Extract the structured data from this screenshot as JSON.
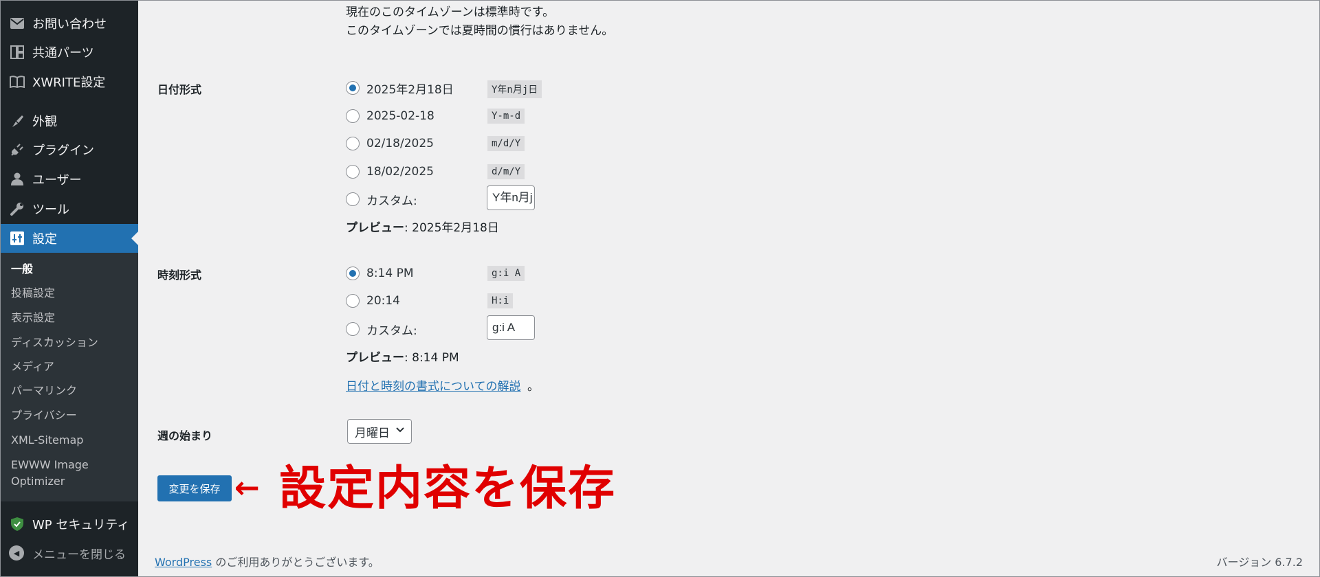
{
  "sidebar": {
    "items": [
      {
        "label": "お問い合わせ",
        "icon": "mail-icon"
      },
      {
        "label": "共通パーツ",
        "icon": "layout-blocks-icon"
      },
      {
        "label": "XWRITE設定",
        "icon": "book-icon"
      },
      {
        "label": "外観",
        "icon": "paintbrush-icon"
      },
      {
        "label": "プラグイン",
        "icon": "plugin-icon"
      },
      {
        "label": "ユーザー",
        "icon": "user-icon"
      },
      {
        "label": "ツール",
        "icon": "wrench-icon"
      },
      {
        "label": "設定",
        "icon": "settings-icon"
      }
    ],
    "submenu": [
      "一般",
      "投稿設定",
      "表示設定",
      "ディスカッション",
      "メディア",
      "パーマリンク",
      "プライバシー",
      "XML-Sitemap",
      "EWWW Image",
      "Optimizer"
    ],
    "security_label": "WP セキュリティ",
    "collapse_label": "メニューを閉じる"
  },
  "timezone": {
    "line1": "現在のこのタイムゾーンは標準時です。",
    "line2": "このタイムゾーンでは夏時間の慣行はありません。"
  },
  "date_format": {
    "heading": "日付形式",
    "options": [
      {
        "label": "2025年2月18日",
        "code": "Y年n月j日"
      },
      {
        "label": "2025-02-18",
        "code": "Y-m-d"
      },
      {
        "label": "02/18/2025",
        "code": "m/d/Y"
      },
      {
        "label": "18/02/2025",
        "code": "d/m/Y"
      }
    ],
    "custom_label": "カスタム:",
    "custom_value": "Y年n月j日",
    "preview_label": "プレビュー",
    "preview_value": ": 2025年2月18日"
  },
  "time_format": {
    "heading": "時刻形式",
    "options": [
      {
        "label": "8:14 PM",
        "code": "g:i A"
      },
      {
        "label": "20:14",
        "code": "H:i"
      }
    ],
    "custom_label": "カスタム:",
    "custom_value": "g:i A",
    "preview_label": "プレビュー",
    "preview_value": ": 8:14 PM",
    "doc_link": "日付と時刻の書式についての解説",
    "doc_suffix": "。"
  },
  "week_start": {
    "heading": "週の始まり",
    "selected": "月曜日"
  },
  "save_label": "変更を保存",
  "annotation": {
    "arrow": "←",
    "text": "設定内容を保存"
  },
  "footer": {
    "link": "WordPress",
    "text": " のご利用ありがとうございます。",
    "version": "バージョン 6.7.2"
  },
  "colors": {
    "sidebar_bg": "#1d2327",
    "submenu_bg": "#2c3338",
    "accent": "#2271b1",
    "annotation": "#e00000",
    "page_bg": "#f0f0f1"
  }
}
